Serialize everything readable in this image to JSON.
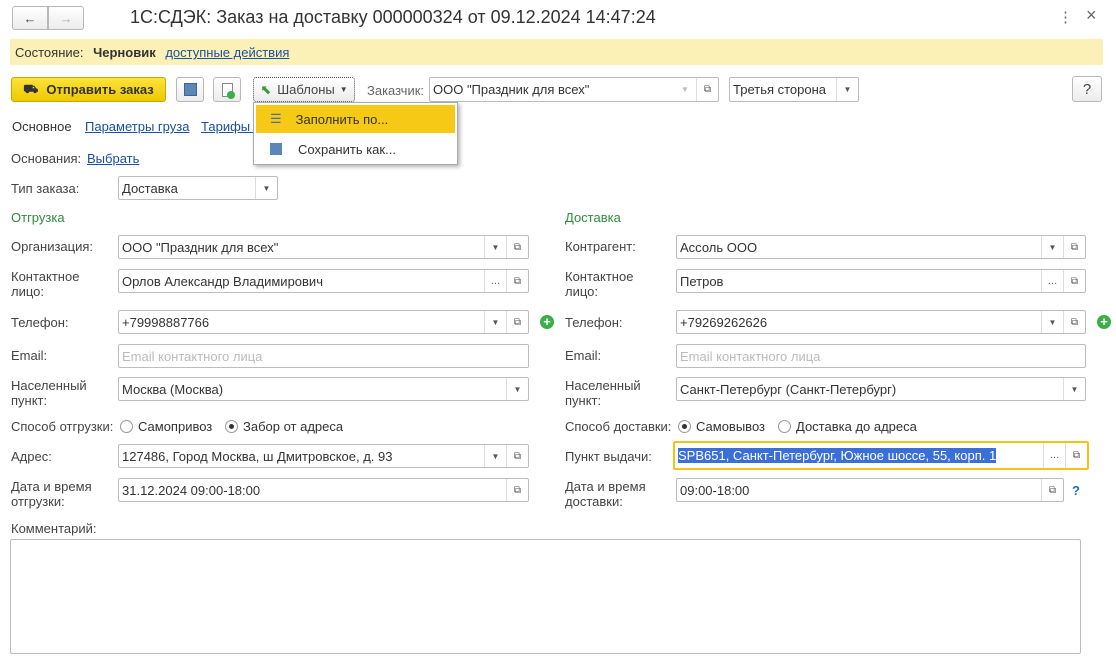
{
  "window": {
    "title": "1С:СДЭК: Заказ на доставку 000000324 от 09.12.2024 14:47:24",
    "back": "←",
    "forward": "→",
    "more": "⋮",
    "close": "×"
  },
  "status": {
    "label": "Состояние:",
    "value": "Черновик",
    "actions": "доступные действия"
  },
  "toolbar": {
    "send": "Отправить заказ",
    "templates": "Шаблоны",
    "customer_label": "Заказчик:",
    "customer": "ООО \"Праздник для всех\"",
    "payer": "Третья сторона",
    "help": "?"
  },
  "menu": {
    "fill": "Заполнить по...",
    "save_as": "Сохранить как..."
  },
  "tabs": [
    "Основное",
    "Параметры груза",
    "Тарифы и"
  ],
  "basis": {
    "label": "Основания:",
    "link": "Выбрать"
  },
  "order_type": {
    "label": "Тип заказа:",
    "value": "Доставка"
  },
  "left": {
    "title": "Отгрузка",
    "org_label": "Организация:",
    "org": "ООО \"Праздник для всех\"",
    "contact_label": "Контактное лицо:",
    "contact": "Орлов Александр Владимирович",
    "phone_label": "Телефон:",
    "phone": "+79998887766",
    "email_label": "Email:",
    "email_ph": "Email контактного лица",
    "city_label": "Населенный пункт:",
    "city": "Москва (Москва)",
    "method_label": "Способ отгрузки:",
    "method_opts": [
      "Самопривоз",
      "Забор от адреса"
    ],
    "method_selected": 1,
    "address_label": "Адрес:",
    "address": "127486, Город Москва, ш Дмитровское, д. 93",
    "date_label": "Дата и время отгрузки:",
    "date": "31.12.2024 09:00-18:00"
  },
  "right": {
    "title": "Доставка",
    "org_label": "Контрагент:",
    "org": "Ассоль ООО",
    "contact_label": "Контактное лицо:",
    "contact": "Петров",
    "phone_label": "Телефон:",
    "phone": "+79269262626",
    "email_label": "Email:",
    "email_ph": "Email контактного лица",
    "city_label": "Населенный пункт:",
    "city": "Санкт-Петербург (Санкт-Петербург)",
    "method_label": "Способ доставки:",
    "method_opts": [
      "Самовывоз",
      "Доставка до адреса"
    ],
    "method_selected": 0,
    "address_label": "Пункт выдачи:",
    "address": "SPB651, Санкт-Петербург, Южное шоссе, 55, корп. 1",
    "date_label": "Дата и время доставки:",
    "date": "09:00-18:00",
    "help": "?"
  },
  "comment": {
    "label": "Комментарий:",
    "value": ""
  },
  "colors": {
    "accent": "#f5d20b",
    "status_bg": "#fbf1b7",
    "section": "#2e8b3e",
    "link": "#1a4fa3"
  }
}
